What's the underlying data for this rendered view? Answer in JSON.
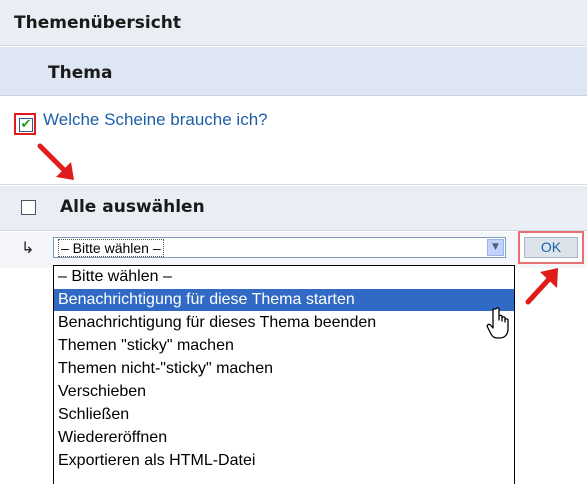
{
  "header": {
    "title": "Themenübersicht"
  },
  "table": {
    "column_title": "Thema"
  },
  "topic": {
    "title": "Welche Scheine brauche ich?",
    "checked": true
  },
  "select_all": {
    "label": "Alle auswählen",
    "checked": false
  },
  "action": {
    "sub_arrow": "↳",
    "select_value": "– Bitte wählen –",
    "ok_label": "OK"
  },
  "dropdown": {
    "options": [
      "– Bitte wählen –",
      "Benachrichtigung für diese Thema starten",
      "Benachrichtigung für dieses Thema beenden",
      "Themen \"sticky\" machen",
      "Themen nicht-\"sticky\" machen",
      "Verschieben",
      "Schließen",
      "Wiedereröffnen",
      "Exportieren als HTML-Datei"
    ],
    "highlighted_index": 1
  },
  "colors": {
    "accent_red": "#e11b1b",
    "selection_blue": "#316ac5",
    "link_blue": "#1c5fa8",
    "check_green": "#1ea21e"
  },
  "icons": [
    "checkbox-checked-icon",
    "checkbox-empty-icon",
    "sub-arrow-icon",
    "dropdown-chevron-icon",
    "red-arrow-icon",
    "hand-cursor-icon"
  ]
}
